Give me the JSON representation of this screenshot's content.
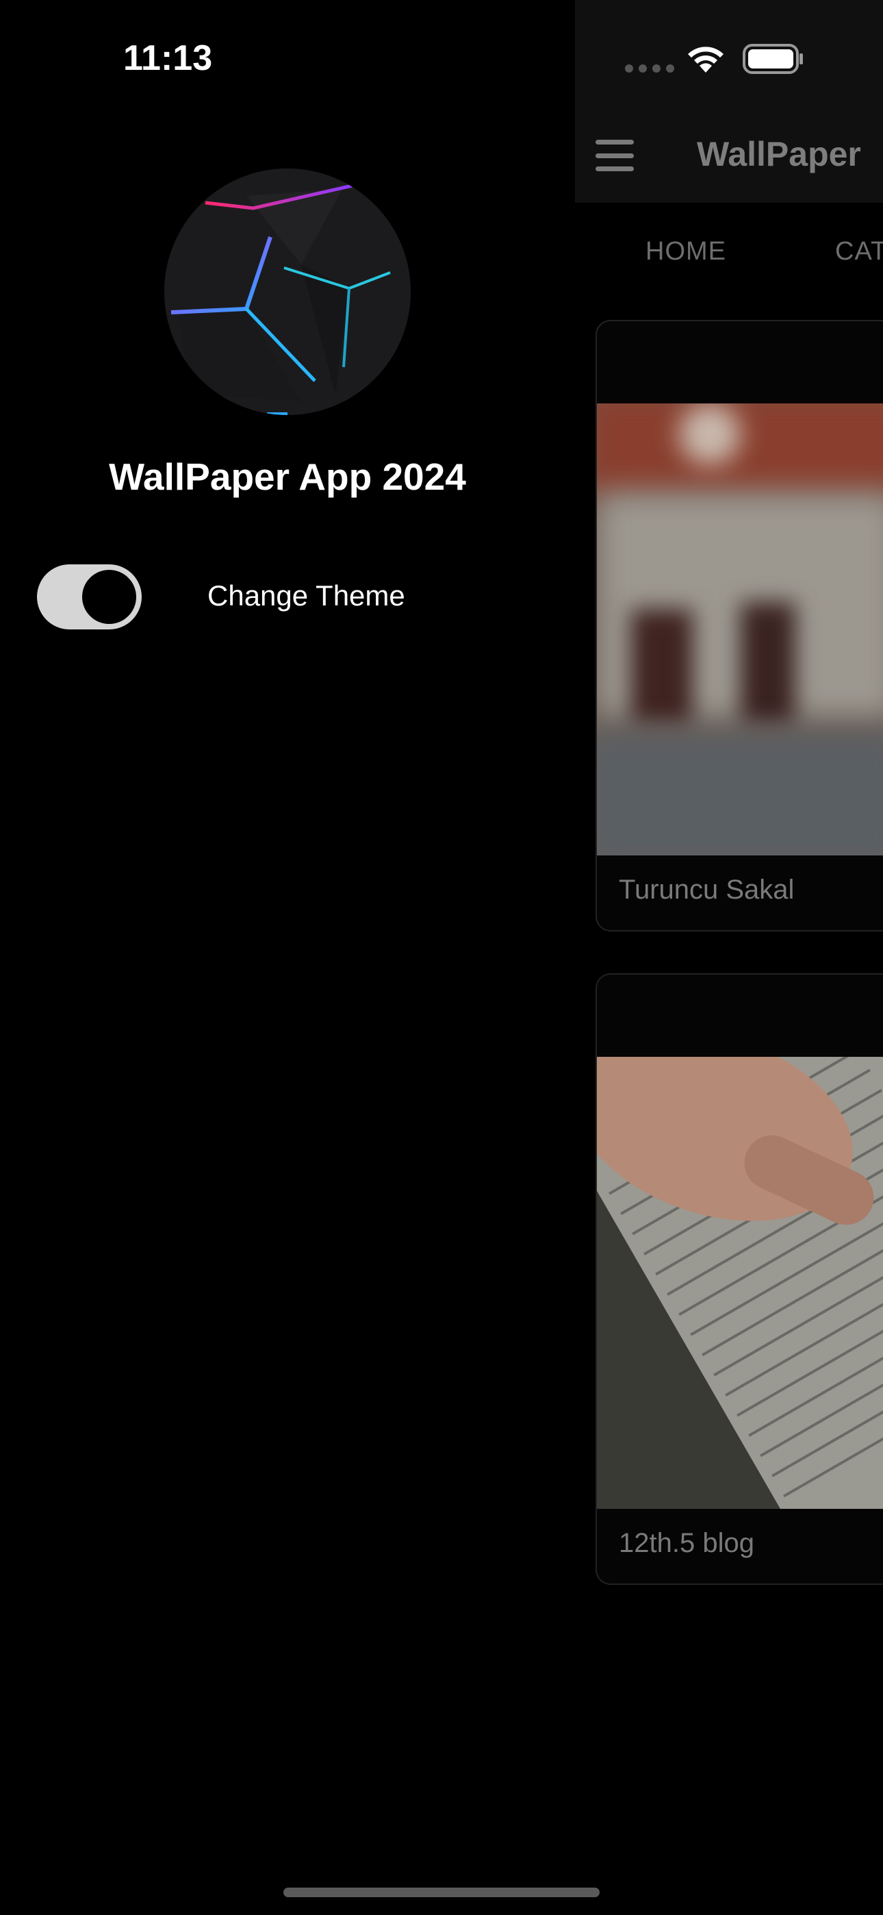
{
  "status_bar": {
    "time": "11:13"
  },
  "drawer": {
    "title": "WallPaper App 2024",
    "theme_toggle": {
      "label": "Change Theme",
      "on": true
    }
  },
  "app_bar": {
    "title": "WallPaper"
  },
  "tabs": [
    {
      "label": "HOME"
    },
    {
      "label": "CAT"
    }
  ],
  "cards": [
    {
      "caption": "Turuncu Sakal"
    },
    {
      "caption": "12th.5 blog"
    }
  ]
}
